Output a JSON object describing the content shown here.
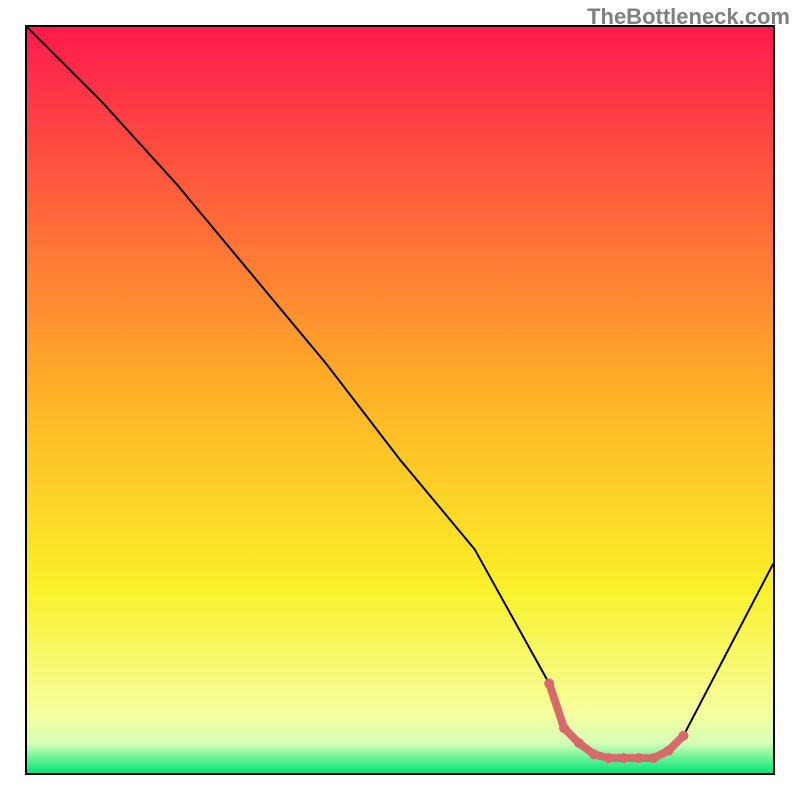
{
  "watermark": "TheBottleneck.com",
  "chart_data": {
    "type": "line",
    "title": "",
    "xlabel": "",
    "ylabel": "",
    "xlim": [
      0,
      100
    ],
    "ylim": [
      0,
      100
    ],
    "series": [
      {
        "name": "curve",
        "x": [
          0,
          10,
          20,
          30,
          40,
          50,
          60,
          70,
          72,
          75,
          78,
          80,
          82,
          85,
          88,
          100
        ],
        "y": [
          100,
          90,
          79,
          67,
          55,
          42,
          30,
          12,
          6,
          3,
          2,
          2,
          2,
          2.5,
          5,
          28
        ],
        "color": "#000000",
        "width": 2
      },
      {
        "name": "highlight",
        "x": [
          70,
          72,
          74,
          76,
          78,
          80,
          82,
          84,
          86,
          88
        ],
        "y": [
          12,
          6,
          4,
          2.5,
          2,
          2,
          2,
          2,
          3,
          5
        ],
        "color": "#d66a6a",
        "width": 8
      }
    ],
    "gradient": {
      "stops": [
        {
          "offset": 0.0,
          "color": "#ff1a4d"
        },
        {
          "offset": 0.5,
          "color": "#ffb426"
        },
        {
          "offset": 0.75,
          "color": "#faf029"
        },
        {
          "offset": 0.92,
          "color": "#f6ff9e"
        },
        {
          "offset": 0.96,
          "color": "#d6ffb8"
        },
        {
          "offset": 1.0,
          "color": "#00e676"
        }
      ]
    }
  }
}
